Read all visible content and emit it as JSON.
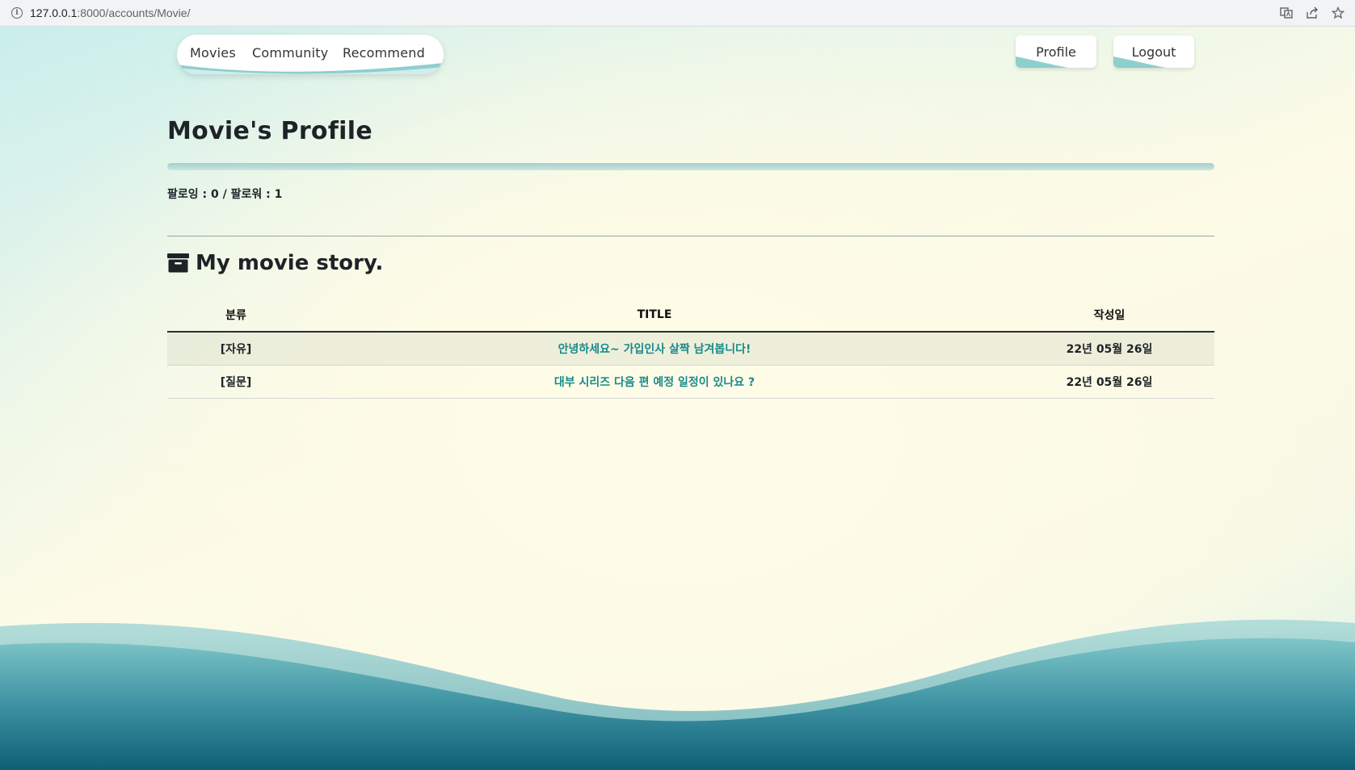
{
  "browser": {
    "url_host": "127.0.0.1",
    "url_rest": ":8000/accounts/Movie/"
  },
  "nav": {
    "items": [
      {
        "label": "Movies"
      },
      {
        "label": "Community"
      },
      {
        "label": "Recommend"
      }
    ],
    "profile_label": "Profile",
    "logout_label": "Logout"
  },
  "profile": {
    "title": "Movie's Profile",
    "follow_text": "팔로잉 : 0 / 팔로워 : 1"
  },
  "story": {
    "heading": "My movie story.",
    "columns": [
      "분류",
      "TITLE",
      "작성일"
    ],
    "rows": [
      {
        "category": "[자유]",
        "title": "안녕하세요~ 가입인사 살짝 남겨봅니다!",
        "date": "22년 05월 26일"
      },
      {
        "category": "[질문]",
        "title": "대부 시리즈 다음 편 예정 일정이 있나요 ?",
        "date": "22년 05월 26일"
      }
    ]
  },
  "colors": {
    "accent_teal": "#1a8a8c",
    "wave_dark": "#136a7f",
    "wave_light": "#8ecfd0"
  }
}
